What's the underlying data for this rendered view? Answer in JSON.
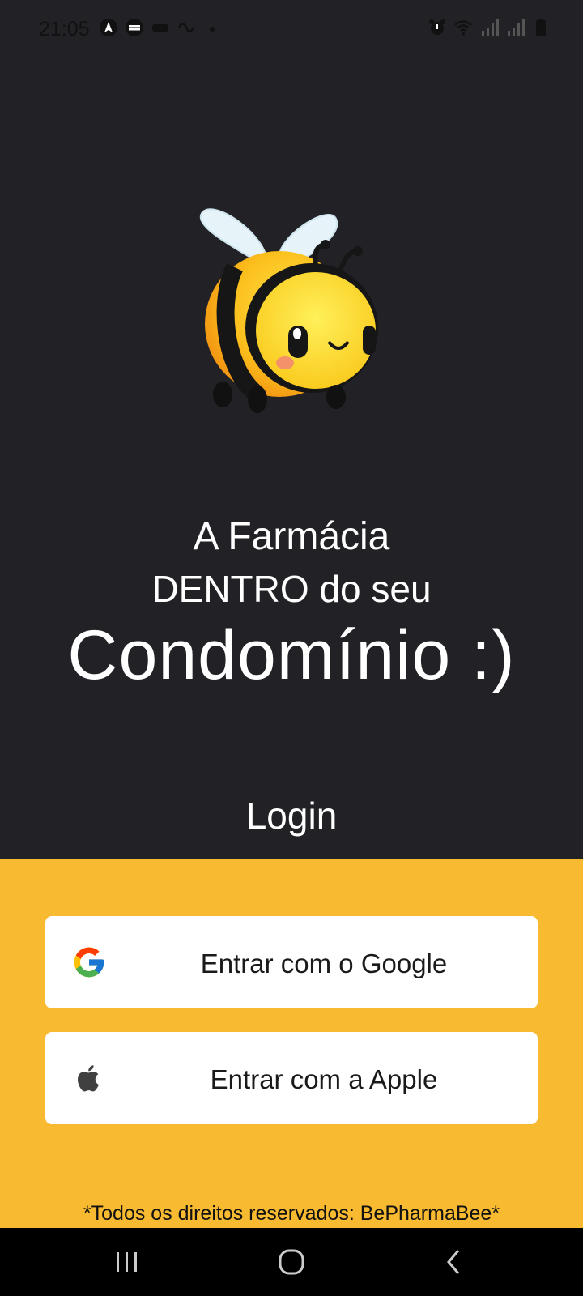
{
  "status_bar": {
    "time": "21:05",
    "icons": [
      "navigation-icon",
      "sync-icon",
      "notification-icon",
      "dot-icon",
      "alarm-icon",
      "wifi-icon",
      "signal-icon",
      "signal-icon",
      "battery-icon"
    ]
  },
  "hero": {
    "image": "bee-mascot",
    "tagline_line1": "A Farmácia",
    "tagline_line2": "DENTRO do seu",
    "tagline_line3": "Condomínio :)"
  },
  "login": {
    "title": "Login",
    "google_label": "Entrar com o Google",
    "apple_label": "Entrar com a Apple"
  },
  "footer": {
    "note": "*Todos os direitos reservados: BePharmaBee*"
  },
  "nav_bar": {
    "icons": [
      "recent-apps-icon",
      "home-icon",
      "back-icon"
    ]
  },
  "colors": {
    "background": "#222126",
    "panel": "#F8BA30",
    "button": "#FFFFFF"
  }
}
